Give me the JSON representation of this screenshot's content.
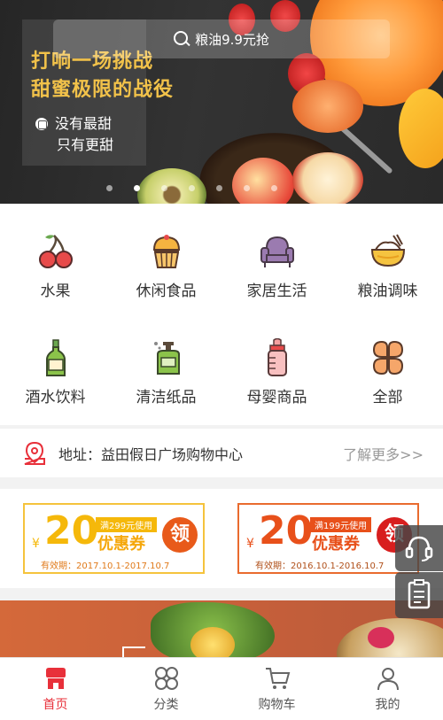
{
  "banner": {
    "search_text": "粮油9.9元抢",
    "title_line1": "打响一场挑战",
    "title_line2": "甜蜜极限的战役",
    "sub_line1": "没有最甜",
    "sub_line2": "只有更甜",
    "dots_count": 8,
    "active_dot": 1
  },
  "categories": [
    {
      "label": "水果",
      "icon": "cherry-icon"
    },
    {
      "label": "休闲食品",
      "icon": "cupcake-icon"
    },
    {
      "label": "家居生活",
      "icon": "armchair-icon"
    },
    {
      "label": "粮油调味",
      "icon": "rice-bowl-icon"
    },
    {
      "label": "酒水饮料",
      "icon": "bottle-icon"
    },
    {
      "label": "清洁纸品",
      "icon": "soap-dispenser-icon"
    },
    {
      "label": "母婴商品",
      "icon": "baby-bottle-icon"
    },
    {
      "label": "全部",
      "icon": "grid-icon"
    }
  ],
  "address": {
    "label": "地址：益田假日广场购物中心",
    "more": "了解更多>>"
  },
  "coupons": [
    {
      "amount": "20",
      "currency": "¥",
      "condition": "满299元使用",
      "name": "优惠券",
      "date": "有效期：2017.10.1-2017.10.7",
      "claim": "领"
    },
    {
      "amount": "20",
      "currency": "¥",
      "condition": "满199元使用",
      "name": "优惠券",
      "date": "有效期：2016.10.1-2016.10.7",
      "claim": "领"
    }
  ],
  "nav": {
    "items": [
      {
        "label": "首页",
        "icon": "store-icon",
        "active": true
      },
      {
        "label": "分类",
        "icon": "category-grid-icon",
        "active": false
      },
      {
        "label": "购物车",
        "icon": "cart-icon",
        "active": false
      },
      {
        "label": "我的",
        "icon": "user-icon",
        "active": false
      }
    ]
  },
  "colors": {
    "accent": "#e8303a",
    "coupon1": "#f5b80a",
    "coupon2": "#e8501a"
  }
}
